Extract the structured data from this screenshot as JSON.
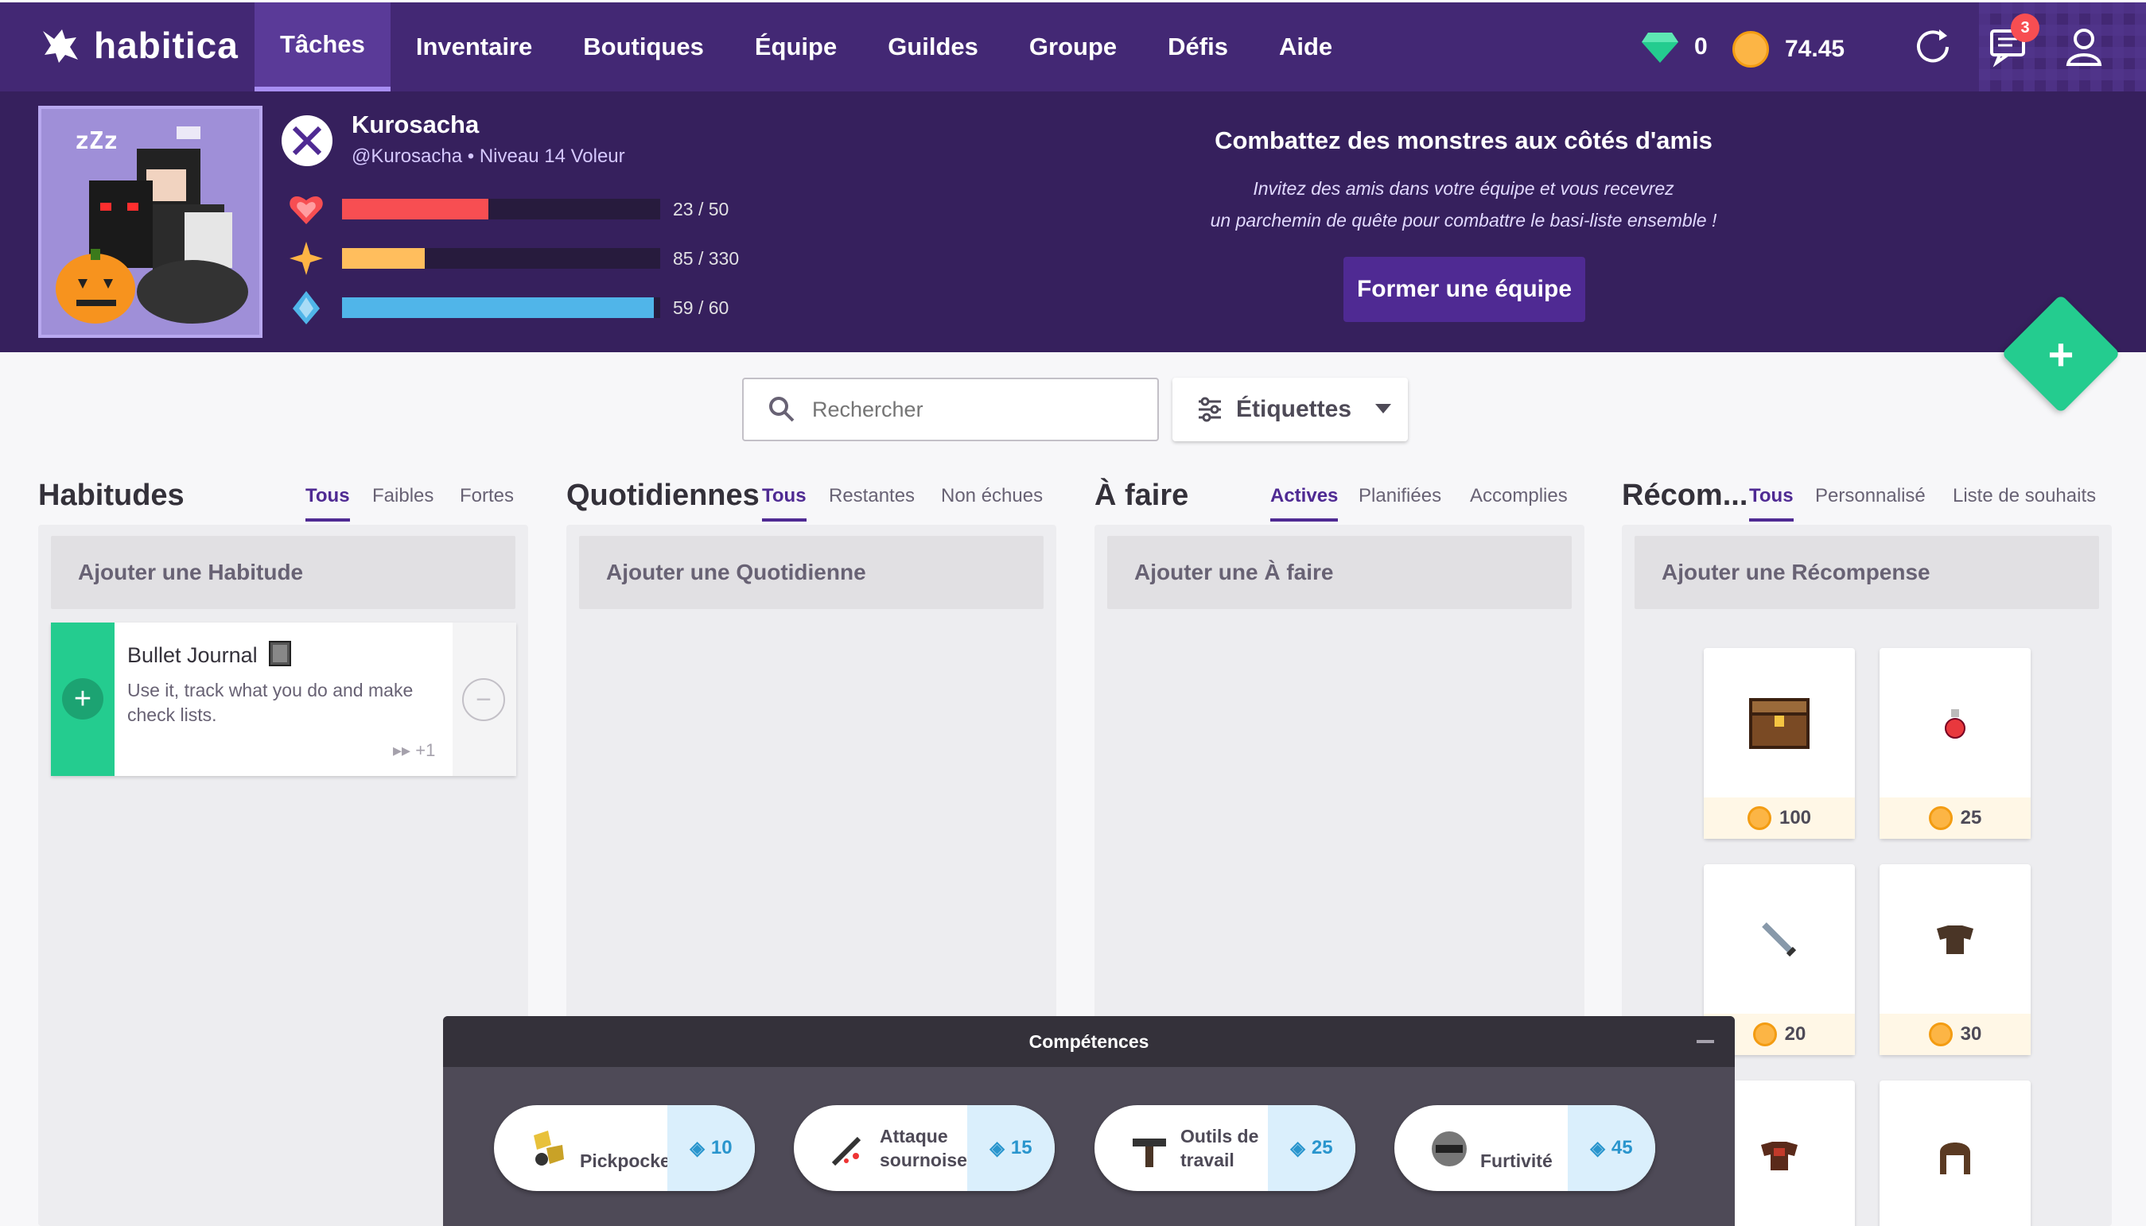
{
  "nav": {
    "brand": "habitica",
    "items": [
      "Tâches",
      "Inventaire",
      "Boutiques",
      "Équipe",
      "Guildes",
      "Groupe",
      "Défis",
      "Aide"
    ],
    "gems": "0",
    "gold": "74.45",
    "notifications_count": "3"
  },
  "profile": {
    "name": "Kurosacha",
    "handle_level": "@Kurosacha • Niveau 14 Voleur",
    "health": {
      "text": "23 / 50",
      "fraction": 0.46,
      "color": "#f74e52"
    },
    "experience": {
      "text": "85 / 330",
      "fraction": 0.26,
      "color": "#ffbe5d"
    },
    "mana": {
      "text": "59 / 60",
      "fraction": 0.98,
      "color": "#50b5e9"
    }
  },
  "party": {
    "title": "Combattez des monstres aux côtés d'amis",
    "line1": "Invitez des amis dans votre équipe et vous recevrez",
    "line2": "un parchemin de quête pour combattre le basi-liste ensemble !",
    "button": "Former une équipe"
  },
  "toolbar": {
    "search_placeholder": "Rechercher",
    "tags_label": "Étiquettes"
  },
  "columns": {
    "habits": {
      "title": "Habitudes",
      "filters": [
        "Tous",
        "Faibles",
        "Fortes"
      ],
      "add": "Ajouter une Habitude"
    },
    "dailies": {
      "title": "Quotidiennes",
      "filters": [
        "Tous",
        "Restantes",
        "Non échues"
      ],
      "add": "Ajouter une Quotidienne"
    },
    "todos": {
      "title": "À faire",
      "filters": [
        "Actives",
        "Planifiées",
        "Accomplies"
      ],
      "add": "Ajouter une À faire"
    },
    "rewards": {
      "title": "Récom...",
      "filters": [
        "Tous",
        "Personnalisé",
        "Liste de souhaits"
      ],
      "add": "Ajouter une Récompense"
    }
  },
  "habit_item": {
    "title": "Bullet Journal",
    "notes": "Use it, track what you do and make check lists.",
    "streak": "+1"
  },
  "rewards": [
    {
      "icon": "chest-icon",
      "price": "100"
    },
    {
      "icon": "potion-icon",
      "price": "25"
    },
    {
      "icon": "sword-icon",
      "price": "20"
    },
    {
      "icon": "armor-icon",
      "price": "30"
    },
    {
      "icon": "armor-red-icon",
      "price": ""
    },
    {
      "icon": "hair-icon",
      "price": ""
    }
  ],
  "skills": {
    "title": "Compétences",
    "items": [
      {
        "name": "Pickpocket",
        "cost": "10"
      },
      {
        "name": "Attaque sournoise",
        "cost": "15"
      },
      {
        "name": "Outils de travail",
        "cost": "25"
      },
      {
        "name": "Furtivité",
        "cost": "45"
      }
    ]
  }
}
